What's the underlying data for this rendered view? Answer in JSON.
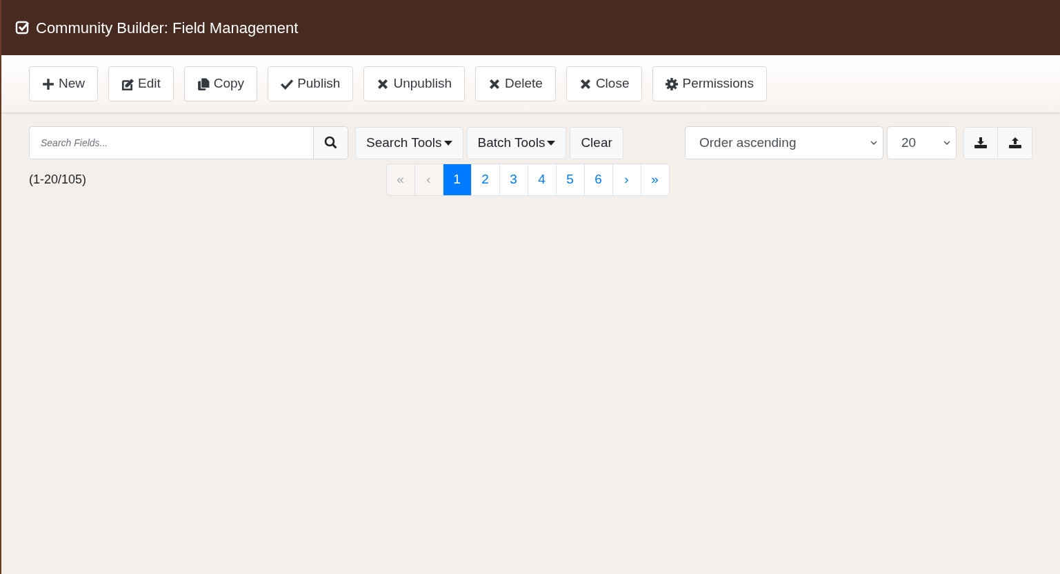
{
  "header": {
    "title": "Community Builder: Field Management"
  },
  "toolbar": [
    {
      "kind": "plus",
      "label": "New"
    },
    {
      "kind": "edit",
      "label": "Edit"
    },
    {
      "kind": "copy",
      "label": "Copy"
    },
    {
      "kind": "check",
      "label": "Publish"
    },
    {
      "kind": "times",
      "label": "Unpublish"
    },
    {
      "kind": "times",
      "label": "Delete"
    },
    {
      "kind": "times",
      "label": "Close"
    },
    {
      "kind": "gear",
      "label": "Permissions"
    }
  ],
  "search": {
    "placeholder": "Search Fields..."
  },
  "filter_buttons": [
    {
      "label": "Search Tools",
      "dropdown": true
    },
    {
      "label": "Batch Tools",
      "dropdown": true
    },
    {
      "label": "Clear",
      "dropdown": false
    }
  ],
  "ordering": {
    "value": "Order ascending"
  },
  "limit": {
    "value": "20"
  },
  "count": "(1-20/105)",
  "pagination": [
    {
      "label": "«",
      "disabled": true,
      "selected": false
    },
    {
      "label": "‹",
      "disabled": true,
      "selected": false
    },
    {
      "label": "1",
      "disabled": false,
      "selected": true
    },
    {
      "label": "2",
      "disabled": false,
      "selected": false
    },
    {
      "label": "3",
      "disabled": false,
      "selected": false
    },
    {
      "label": "4",
      "disabled": false,
      "selected": false
    },
    {
      "label": "5",
      "disabled": false,
      "selected": false
    },
    {
      "label": "6",
      "disabled": false,
      "selected": false
    },
    {
      "label": "›",
      "disabled": false,
      "selected": false
    },
    {
      "label": "»",
      "disabled": false,
      "selected": false
    }
  ]
}
